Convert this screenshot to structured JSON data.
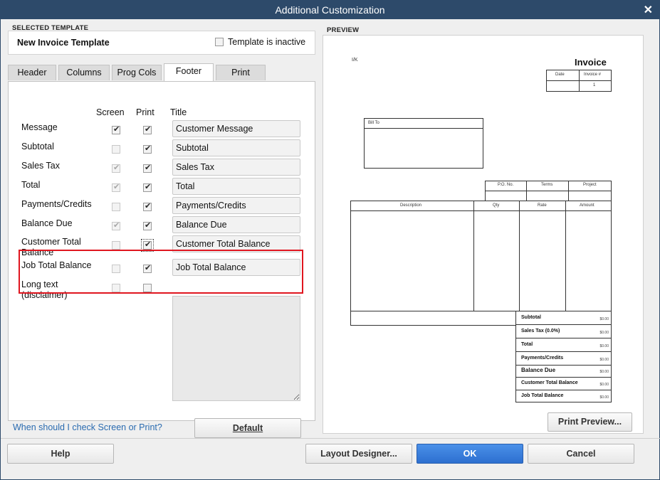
{
  "window": {
    "title": "Additional Customization"
  },
  "selected_template": {
    "label": "SELECTED TEMPLATE",
    "name": "New Invoice Template",
    "inactive_label": "Template is inactive",
    "inactive_checked": false
  },
  "tabs": [
    {
      "label": "Header",
      "active": false
    },
    {
      "label": "Columns",
      "active": false
    },
    {
      "label": "Prog Cols",
      "active": false
    },
    {
      "label": "Footer",
      "active": true
    },
    {
      "label": "Print",
      "active": false
    }
  ],
  "footer": {
    "col_screen": "Screen",
    "col_print": "Print",
    "col_title": "Title",
    "rows": [
      {
        "label": "Message",
        "screen": true,
        "screen_enabled": true,
        "print": true,
        "title": "Customer Message"
      },
      {
        "label": "Subtotal",
        "screen": false,
        "screen_enabled": false,
        "print": true,
        "title": "Subtotal"
      },
      {
        "label": "Sales Tax",
        "screen": true,
        "screen_enabled": false,
        "print": true,
        "title": "Sales Tax"
      },
      {
        "label": "Total",
        "screen": true,
        "screen_enabled": false,
        "print": true,
        "title": "Total"
      },
      {
        "label": "Payments/Credits",
        "screen": false,
        "screen_enabled": false,
        "print": true,
        "title": "Payments/Credits"
      },
      {
        "label": "Balance Due",
        "screen": true,
        "screen_enabled": false,
        "print": true,
        "title": "Balance Due"
      },
      {
        "label": "Customer Total Balance",
        "screen": false,
        "screen_enabled": false,
        "print": true,
        "title": "Customer Total Balance"
      },
      {
        "label": "Job Total Balance",
        "screen": false,
        "screen_enabled": false,
        "print": true,
        "title": "Job Total Balance"
      },
      {
        "label": "Long text (disclaimer)",
        "screen": false,
        "screen_enabled": false,
        "print": false,
        "title": ""
      }
    ]
  },
  "help_link": "When should I check Screen or Print?",
  "buttons": {
    "default": "Default",
    "help": "Help",
    "layout_designer": "Layout Designer...",
    "ok": "OK",
    "cancel": "Cancel",
    "print_preview": "Print Preview..."
  },
  "preview": {
    "label": "PREVIEW",
    "logo_text": "I/K",
    "doc_title": "Invoice",
    "date_label": "Date",
    "invoice_no_label": "Invoice #",
    "invoice_no": "1",
    "bill_to": "Bill To",
    "po_label": "P.O. No.",
    "terms_label": "Terms",
    "project_label": "Project",
    "col_description": "Description",
    "col_qty": "Qty",
    "col_rate": "Rate",
    "col_amount": "Amount",
    "totals": [
      {
        "label": "Subtotal",
        "value": "$0.00"
      },
      {
        "label": "Sales Tax  (0.0%)",
        "value": "$0.00"
      },
      {
        "label": "Total",
        "value": "$0.00"
      },
      {
        "label": "Payments/Credits",
        "value": "$0.00"
      },
      {
        "label": "Balance Due",
        "value": "$0.00"
      },
      {
        "label": "Customer Total Balance",
        "value": "$0.00"
      },
      {
        "label": "Job Total Balance",
        "value": "$0.00"
      }
    ]
  }
}
